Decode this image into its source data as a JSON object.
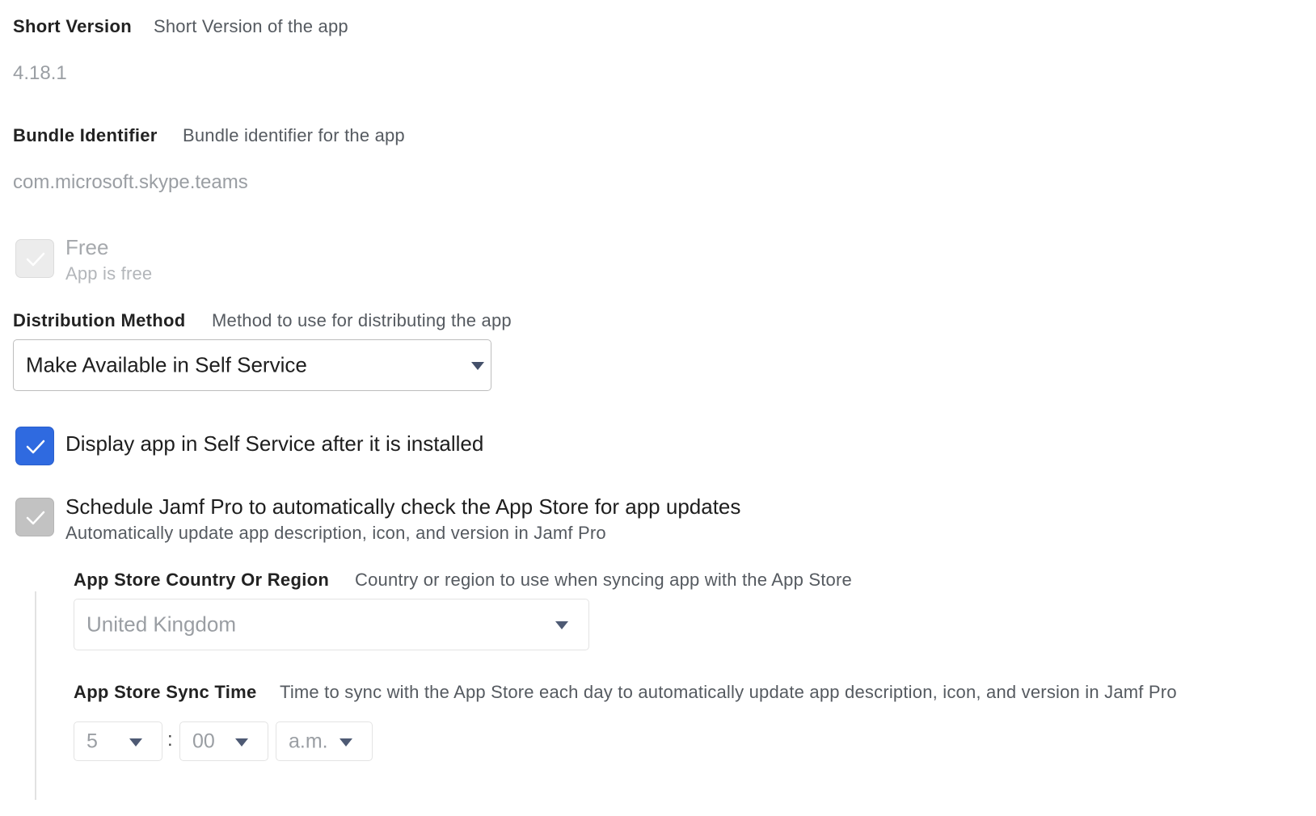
{
  "short_version": {
    "label": "Short Version",
    "description": "Short Version of the app",
    "value": "4.18.1"
  },
  "bundle_identifier": {
    "label": "Bundle Identifier",
    "description": "Bundle identifier for the app",
    "value": "com.microsoft.skype.teams"
  },
  "free": {
    "label": "Free",
    "sublabel": "App is free",
    "checked": true,
    "disabled": true
  },
  "distribution_method": {
    "label": "Distribution Method",
    "description": "Method to use for distributing the app",
    "selected": "Make Available in Self Service"
  },
  "display_after_install": {
    "label": "Display app in Self Service after it is installed",
    "checked": true
  },
  "schedule_check": {
    "label": "Schedule Jamf Pro to automatically check the App Store for app updates",
    "sublabel": "Automatically update app description, icon, and version in Jamf Pro",
    "checked": true,
    "disabled": true
  },
  "country_region": {
    "label": "App Store Country Or Region",
    "description": "Country or region to use when syncing app with the App Store",
    "selected": "United Kingdom"
  },
  "sync_time": {
    "label": "App Store Sync Time",
    "description": "Time to sync with the App Store each day to automatically update app description, icon, and version in Jamf Pro",
    "hour": "5",
    "separator": ":",
    "minute": "00",
    "period": "a.m."
  },
  "colors": {
    "accent": "#2f6ae0",
    "disabled_text": "#9a9ea3"
  }
}
